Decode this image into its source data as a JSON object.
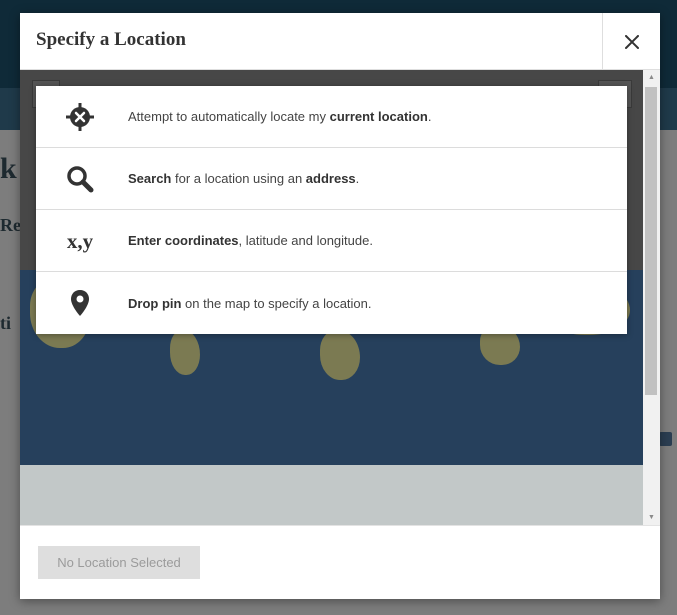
{
  "modal": {
    "title": "Specify a Location",
    "close_icon": "close-icon"
  },
  "options": [
    {
      "icon": "crosshair-locate-icon",
      "pre": "Attempt to automatically locate my ",
      "bold": "current location",
      "post": "."
    },
    {
      "icon": "magnifier-search-icon",
      "bold": "Search",
      "mid": " for a location using an ",
      "bold2": "address",
      "post": "."
    },
    {
      "icon_text": "x,y",
      "bold": "Enter coordinates",
      "post": ", latitude and longitude."
    },
    {
      "icon": "map-pin-icon",
      "bold": "Drop pin",
      "post": " on the map to specify a location."
    }
  ],
  "footer": {
    "button_label": "No Location Selected"
  },
  "colors": {
    "backdrop": "#7a7a7a",
    "map_ocean": "#26405c",
    "map_land": "#7b7a52",
    "disabled_button": "#dedede"
  }
}
